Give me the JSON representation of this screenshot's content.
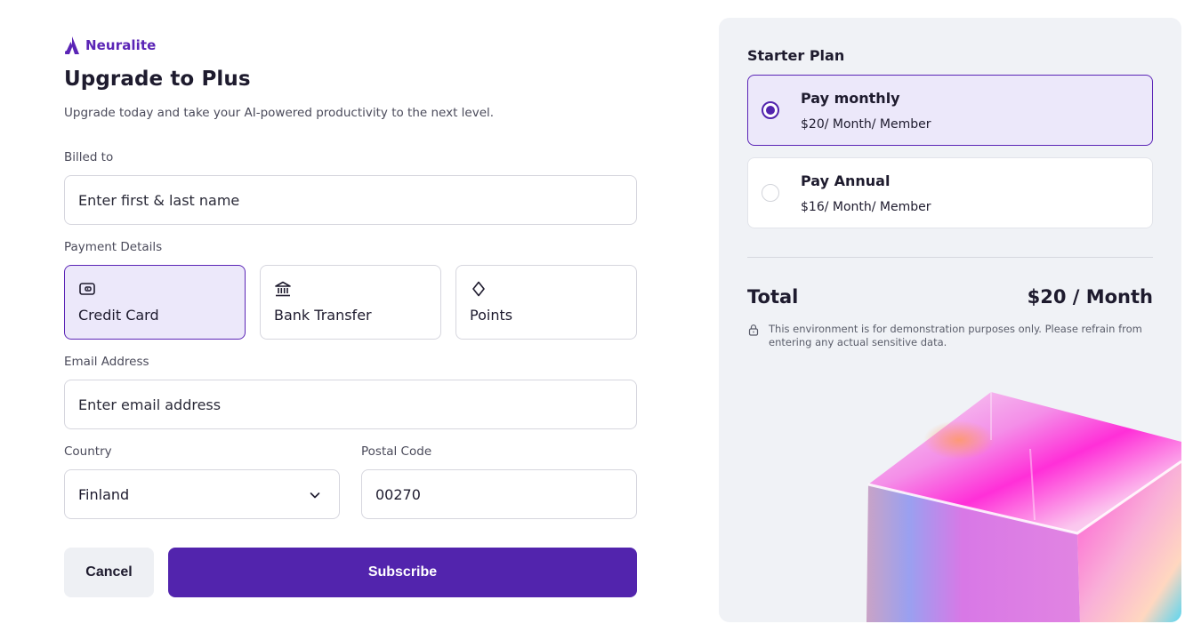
{
  "brand": {
    "name": "Neuralite"
  },
  "header": {
    "title": "Upgrade to Plus",
    "subtitle": "Upgrade today and take your AI-powered productivity to the next level."
  },
  "form": {
    "billed_to": {
      "label": "Billed to",
      "placeholder": "Enter first & last name"
    },
    "payment": {
      "label": "Payment Details",
      "options": [
        {
          "label": "Credit Card",
          "icon": "wallet-icon",
          "selected": true
        },
        {
          "label": "Bank Transfer",
          "icon": "bank-icon",
          "selected": false
        },
        {
          "label": "Points",
          "icon": "diamond-icon",
          "selected": false
        }
      ]
    },
    "email": {
      "label": "Email Address",
      "placeholder": "Enter email address"
    },
    "country": {
      "label": "Country",
      "value": "Finland"
    },
    "postal": {
      "label": "Postal Code",
      "value": "00270"
    },
    "cancel_label": "Cancel",
    "subscribe_label": "Subscribe"
  },
  "plan": {
    "title": "Starter Plan",
    "options": [
      {
        "name": "Pay monthly",
        "price": "$20/ Month/ Member",
        "selected": true
      },
      {
        "name": "Pay Annual",
        "price": "$16/ Month/ Member",
        "selected": false
      }
    ],
    "total_label": "Total",
    "total_value": "$20 / Month",
    "notice": "This environment is for demonstration purposes only. Please refrain from entering any actual sensitive data."
  },
  "colors": {
    "accent": "#5224ad",
    "selected_bg": "#ece8fa",
    "panel_bg": "#f0f2f6"
  }
}
